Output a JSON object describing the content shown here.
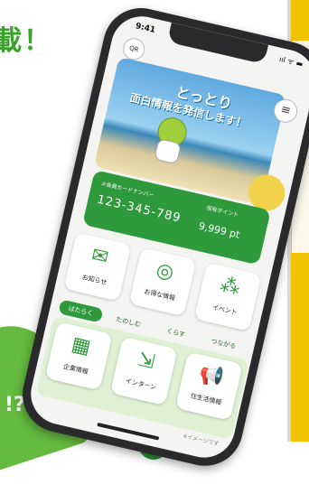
{
  "background": {
    "headline": "載！",
    "blob_text": "!?",
    "colors": {
      "green": "#3aa12a",
      "accent_yellow": "#f2c400"
    }
  },
  "status": {
    "time": "9:41",
    "signal_icons": "ııl ᯤ ▬"
  },
  "header": {
    "qr_label": "QR",
    "menu_icon": "≡"
  },
  "hero": {
    "title_line1": "とっとり",
    "title_line2": "面白情報を発信します！"
  },
  "card": {
    "member_label": "メ会員カードナンバー",
    "member_number": "123-345-789",
    "points_label": "保有ポイント",
    "points_value": "9,999 pt"
  },
  "tiles": [
    {
      "label": "お知らせ",
      "icon": "✉"
    },
    {
      "label": "お得な情報",
      "icon": "◎"
    },
    {
      "label": "イベント",
      "icon": "⁂"
    }
  ],
  "tabs": [
    {
      "label": "はたらく",
      "active": true
    },
    {
      "label": "たのしむ",
      "active": false
    },
    {
      "label": "くらす",
      "active": false
    },
    {
      "label": "つながる",
      "active": false
    }
  ],
  "lower_tiles": [
    {
      "label": "企業情報",
      "icon": "▦"
    },
    {
      "label": "インターン",
      "icon": "⇲"
    },
    {
      "label": "住生活情報",
      "icon": "📢"
    }
  ],
  "footnote": "※イメージです"
}
